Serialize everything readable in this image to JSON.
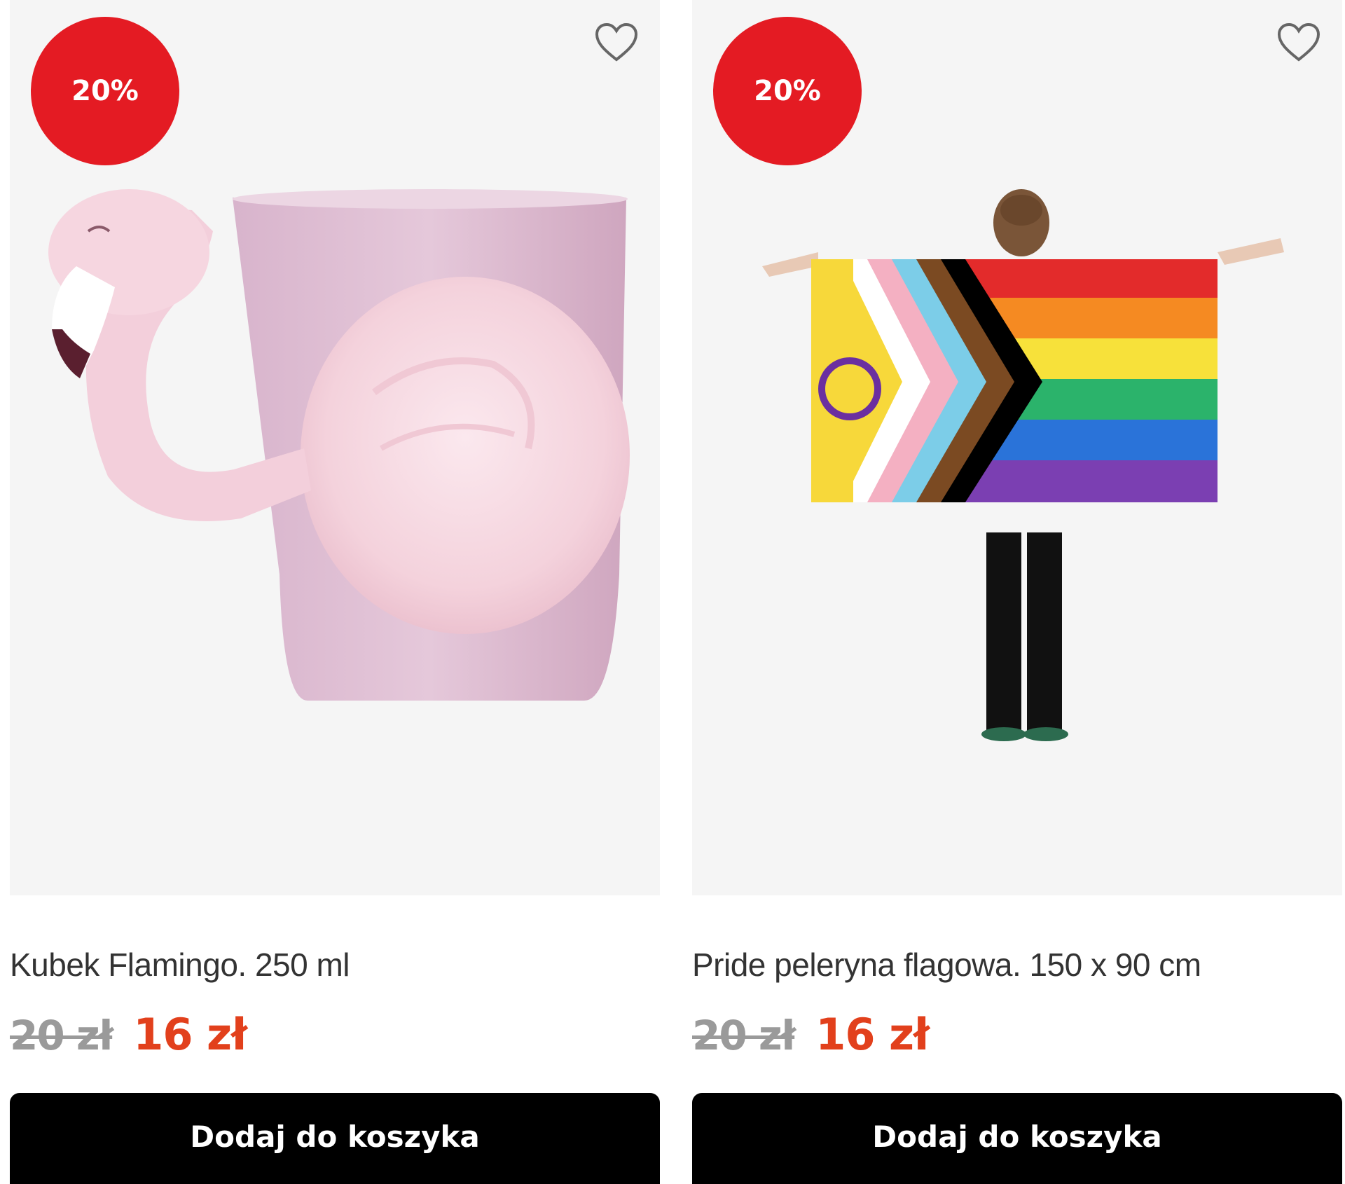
{
  "products": [
    {
      "discount_badge": "20%",
      "favorite_icon": "heart-outline-icon",
      "image": "pink flamingo mug",
      "title": "Kubek Flamingo. 250 ml",
      "old_price": "20 zł",
      "new_price": "16 zł",
      "cart_button": "Dodaj do koszyka"
    },
    {
      "discount_badge": "20%",
      "favorite_icon": "heart-outline-icon",
      "image": "person wearing pride flag cape",
      "title": "Pride peleryna flagowa. 150 x 90 cm",
      "old_price": "20 zł",
      "new_price": "16 zł",
      "cart_button": "Dodaj do koszyka"
    }
  ],
  "colors": {
    "badge": "#e41b23",
    "new_price": "#e2401c",
    "old_price": "#9a9a9a",
    "button": "#000000",
    "image_bg": "#f5f5f5"
  }
}
